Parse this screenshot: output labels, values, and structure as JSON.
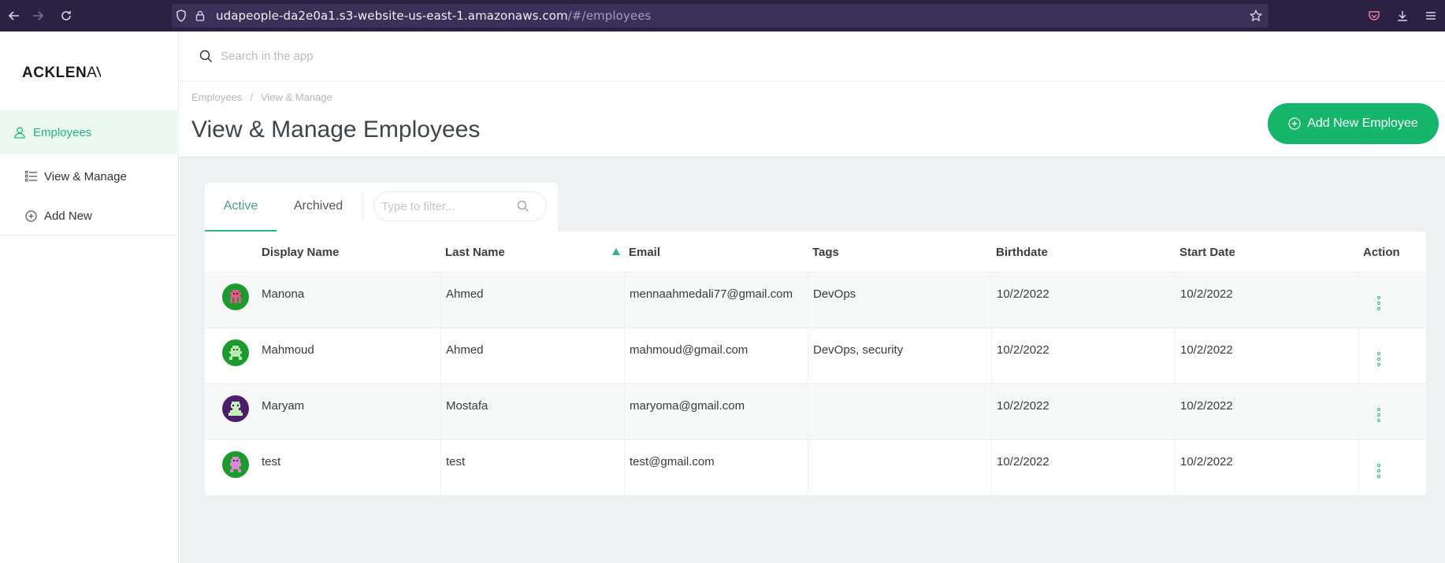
{
  "browser": {
    "url_main": "udapeople-da2e0a1.s3-website-us-east-1.amazonaws.com",
    "url_path": "/#/employees"
  },
  "sidebar": {
    "logo_bold": "ACKLEN",
    "logo_thin": "AV",
    "items": [
      {
        "label": "Employees",
        "icon": "user-icon",
        "active": true
      },
      {
        "label": "View & Manage",
        "icon": "list-icon",
        "active": false
      },
      {
        "label": "Add New",
        "icon": "plus-circle-icon",
        "active": false
      }
    ]
  },
  "search": {
    "placeholder": "Search in the app"
  },
  "header": {
    "breadcrumb": [
      "Employees",
      "View & Manage"
    ],
    "breadcrumb_sep": "/",
    "title": "View & Manage Employees",
    "add_button": "Add New Employee"
  },
  "tabs": [
    {
      "label": "Active",
      "active": true
    },
    {
      "label": "Archived",
      "active": false
    }
  ],
  "filter": {
    "placeholder": "Type to filter..."
  },
  "table": {
    "columns": [
      "Display Name",
      "Last Name",
      "Email",
      "Tags",
      "Birthdate",
      "Start Date",
      "Action"
    ],
    "sorted_column": "Last Name",
    "sort_direction": "ascending",
    "rows": [
      {
        "display_name": "Manona",
        "last_name": "Ahmed",
        "email": "mennaahmedali77@gmail.com",
        "tags": "DevOps",
        "birthdate": "10/2/2022",
        "start_date": "10/2/2022",
        "avatar_bg": "#1c9a2e",
        "avatar_fg": "#e05a8a"
      },
      {
        "display_name": "Mahmoud",
        "last_name": "Ahmed",
        "email": "mahmoud@gmail.com",
        "tags": "DevOps, security",
        "birthdate": "10/2/2022",
        "start_date": "10/2/2022",
        "avatar_bg": "#1c9a2e",
        "avatar_fg": "#b9e8b0"
      },
      {
        "display_name": "Maryam",
        "last_name": "Mostafa",
        "email": "maryoma@gmail.com",
        "tags": "",
        "birthdate": "10/2/2022",
        "start_date": "10/2/2022",
        "avatar_bg": "#4b1d6b",
        "avatar_fg": "#c7f0b8"
      },
      {
        "display_name": "test",
        "last_name": "test",
        "email": "test@gmail.com",
        "tags": "",
        "birthdate": "10/2/2022",
        "start_date": "10/2/2022",
        "avatar_bg": "#1c9a2e",
        "avatar_fg": "#d98bd0"
      }
    ]
  },
  "colors": {
    "accent": "#16b66a",
    "browser_bar": "#2b2143",
    "content_bg": "#eef1f1"
  }
}
